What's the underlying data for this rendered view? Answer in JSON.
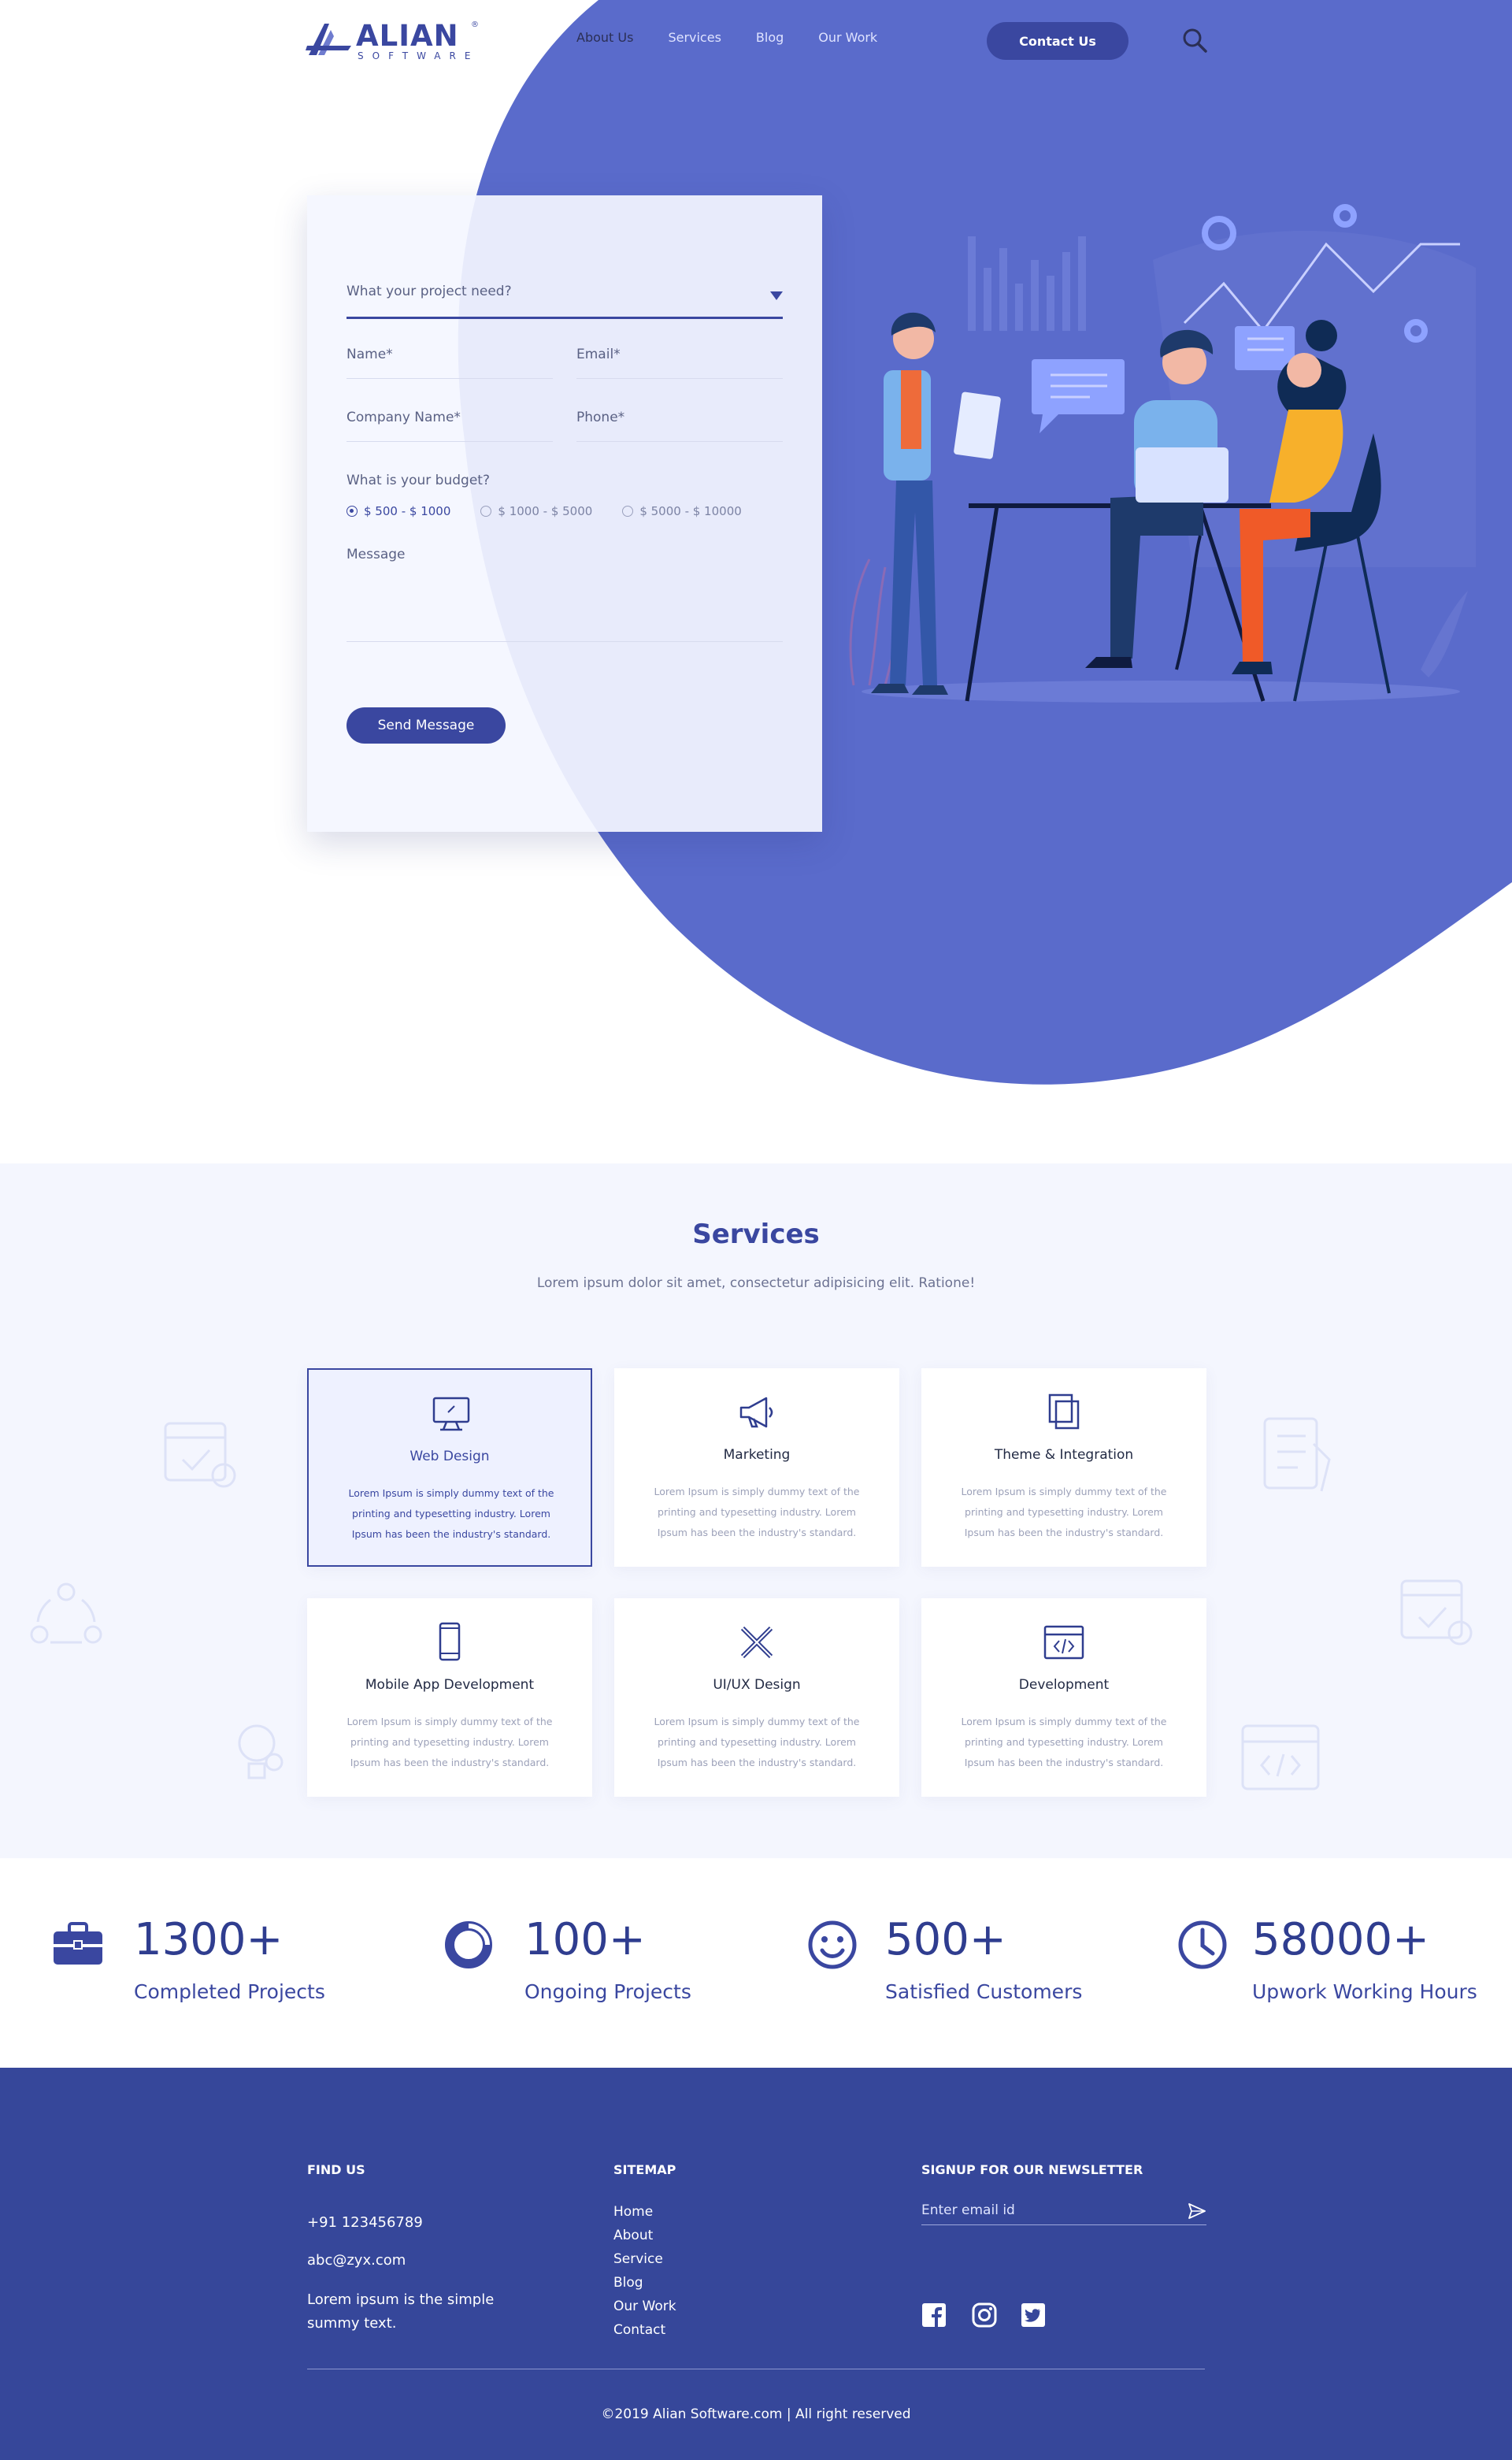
{
  "brand": {
    "name": "ALIAN",
    "tagline": "SOFTWARE",
    "mark": "®"
  },
  "nav": {
    "items": [
      "About Us",
      "Services",
      "Blog",
      "Our Work"
    ],
    "cta": "Contact Us"
  },
  "form": {
    "project_select": "What your project need?",
    "name": "Name*",
    "email": "Email*",
    "company": "Company Name*",
    "phone": "Phone*",
    "budget_label": "What is your budget?",
    "budget_options": [
      "$ 500 - $ 1000",
      "$ 1000  -  $ 5000",
      "$ 5000  -  $ 10000"
    ],
    "budget_selected": "$ 500 - $ 1000",
    "message": "Message",
    "submit": "Send Message"
  },
  "services": {
    "title": "Services",
    "subtitle": "Lorem ipsum dolor sit amet, consectetur adipisicing elit. Ratione!",
    "cards": [
      {
        "title": "Web Design",
        "text": "Lorem Ipsum is simply dummy text of the printing and typesetting industry. Lorem Ipsum has been the industry's standard.",
        "icon": "monitor-icon",
        "active": true
      },
      {
        "title": "Marketing",
        "text": "Lorem Ipsum is simply dummy text of the printing and typesetting industry. Lorem Ipsum has been the industry's standard.",
        "icon": "megaphone-icon",
        "active": false
      },
      {
        "title": "Theme & Integration",
        "text": "Lorem Ipsum is simply dummy text of the printing and typesetting industry. Lorem Ipsum has been the industry's standard.",
        "icon": "layers-icon",
        "active": false
      },
      {
        "title": "Mobile App Development",
        "text": "Lorem Ipsum is simply dummy text of the printing and typesetting industry. Lorem Ipsum has been the industry's standard.",
        "icon": "smartphone-icon",
        "active": false
      },
      {
        "title": "UI/UX Design",
        "text": "Lorem Ipsum is simply dummy text of the printing and typesetting industry. Lorem Ipsum has been the industry's standard.",
        "icon": "pencil-ruler-icon",
        "active": false
      },
      {
        "title": "Development",
        "text": "Lorem Ipsum is simply dummy text of the printing and typesetting industry. Lorem Ipsum has been the industry's standard.",
        "icon": "code-window-icon",
        "active": false
      }
    ]
  },
  "stats": [
    {
      "value": "1300+",
      "label": "Completed Projects",
      "icon": "briefcase-icon"
    },
    {
      "value": "100+",
      "label": "Ongoing Projects",
      "icon": "progress-ring-icon"
    },
    {
      "value": "500+",
      "label": "Satisfied Customers",
      "icon": "smiley-icon"
    },
    {
      "value": "58000+",
      "label": "Upwork Working Hours",
      "icon": "clock-icon"
    }
  ],
  "footer": {
    "find_us": {
      "heading": "FIND US",
      "phone": "+91 123456789",
      "email": "abc@zyx.com",
      "text_line1": "Lorem ipsum is the simple",
      "text_line2": "summy text."
    },
    "sitemap": {
      "heading": "SITEMAP",
      "links": [
        "Home",
        "About",
        "Service",
        "Blog",
        "Our Work",
        "Contact"
      ]
    },
    "newsletter": {
      "heading": "SIGNUP FOR OUR NEWSLETTER",
      "placeholder": "Enter email id"
    },
    "social": [
      "facebook-icon",
      "instagram-icon",
      "twitter-icon"
    ],
    "copyright": "©2019 Alian Software.com  |  All right reserved"
  },
  "colors": {
    "primary": "#3a47a0",
    "blob": "#5a6bcb",
    "footer": "#36479a",
    "services_bg": "#f4f6fe"
  }
}
